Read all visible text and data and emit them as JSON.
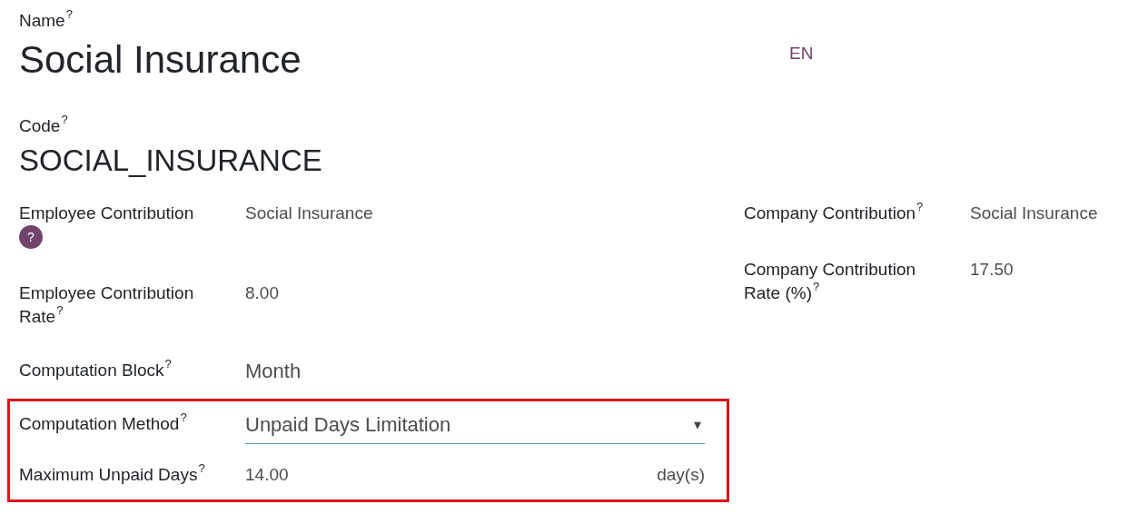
{
  "name_field": {
    "label": "Name",
    "help": "?",
    "value": "Social Insurance",
    "lang": "EN"
  },
  "code_field": {
    "label": "Code",
    "help": "?",
    "value": "SOCIAL_INSURANCE"
  },
  "left_fields": [
    {
      "kind": "text",
      "label": "Employee Contribution",
      "help": "?",
      "help_badge": true,
      "value": "Social Insurance"
    },
    {
      "kind": "text",
      "label": "Employee Contribution Rate",
      "help": "?",
      "help_badge": false,
      "value": "8.00"
    },
    {
      "kind": "block",
      "label": "Computation Block",
      "help": "?",
      "help_badge": false,
      "value": "Month"
    }
  ],
  "highlighted_fields": [
    {
      "kind": "select",
      "label": "Computation Method",
      "help": "?",
      "value": "Unpaid Days Limitation",
      "caret": "▾"
    },
    {
      "kind": "unit",
      "label": "Maximum Unpaid Days",
      "help": "?",
      "value": "14.00",
      "unit": "day(s)"
    }
  ],
  "right_fields": [
    {
      "label": "Company Contribution",
      "help": "?",
      "help_badge": false,
      "value": "Social Insurance"
    },
    {
      "label": "Company Contribution Rate (%)",
      "help": "?",
      "help_badge": false,
      "value": "17.50"
    }
  ]
}
